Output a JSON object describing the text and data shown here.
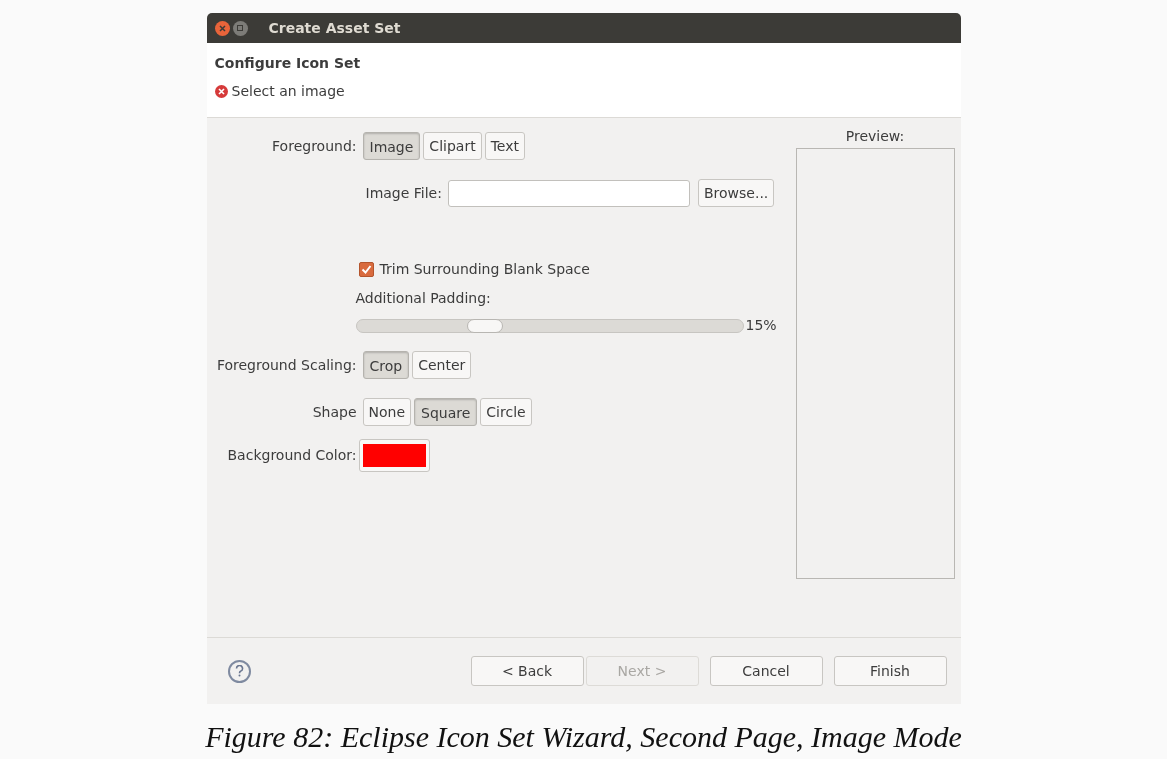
{
  "window": {
    "title": "Create Asset Set"
  },
  "header": {
    "title": "Configure Icon Set",
    "message": "Select an image"
  },
  "foreground": {
    "label": "Foreground:",
    "options": [
      {
        "label": "Image",
        "selected": true
      },
      {
        "label": "Clipart",
        "selected": false
      },
      {
        "label": "Text",
        "selected": false
      }
    ]
  },
  "image_file": {
    "label": "Image File:",
    "button": "Browse..."
  },
  "trim": {
    "label": "Trim Surrounding Blank Space",
    "checked": true
  },
  "padding": {
    "label": "Additional Padding:",
    "level": 0.3,
    "reading": "15%"
  },
  "scaling": {
    "label": "Foreground Scaling:",
    "options": [
      {
        "label": "Crop",
        "selected": true
      },
      {
        "label": "Center",
        "selected": false
      }
    ]
  },
  "shape": {
    "label": "Shape",
    "options": [
      {
        "label": "None",
        "selected": false
      },
      {
        "label": "Square",
        "selected": true
      },
      {
        "label": "Circle",
        "selected": false
      }
    ]
  },
  "background_color": {
    "label": "Background Color:",
    "color": "#ff0000"
  },
  "preview": {
    "label": "Preview:"
  },
  "buttons": [
    {
      "label": "< Back",
      "disabled": false
    },
    {
      "label": "Next >",
      "disabled": true
    },
    {
      "label": "Cancel",
      "disabled": false
    },
    {
      "label": "Finish",
      "disabled": false
    }
  ],
  "caption": "Figure 82: Eclipse Icon Set Wizard, Second Page, Image Mode"
}
